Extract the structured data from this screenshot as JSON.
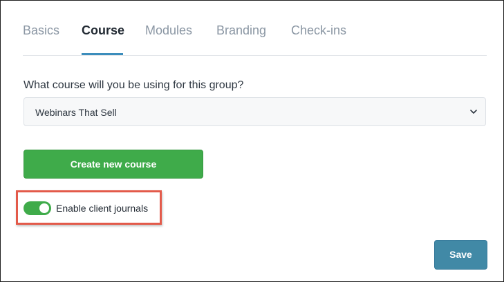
{
  "tabs": [
    {
      "label": "Basics",
      "active": false
    },
    {
      "label": "Course",
      "active": true
    },
    {
      "label": "Modules",
      "active": false
    },
    {
      "label": "Branding",
      "active": false
    },
    {
      "label": "Check-ins",
      "active": false
    }
  ],
  "course": {
    "question": "What course will you be using for this group?",
    "selected": "Webinars That Sell",
    "create_label": "Create new course"
  },
  "journals": {
    "label": "Enable client journals",
    "enabled": true
  },
  "actions": {
    "save_label": "Save"
  },
  "colors": {
    "accent": "#3c8dbc",
    "green": "#3fab4a",
    "save": "#4189a6",
    "highlight": "#e35a4a"
  }
}
